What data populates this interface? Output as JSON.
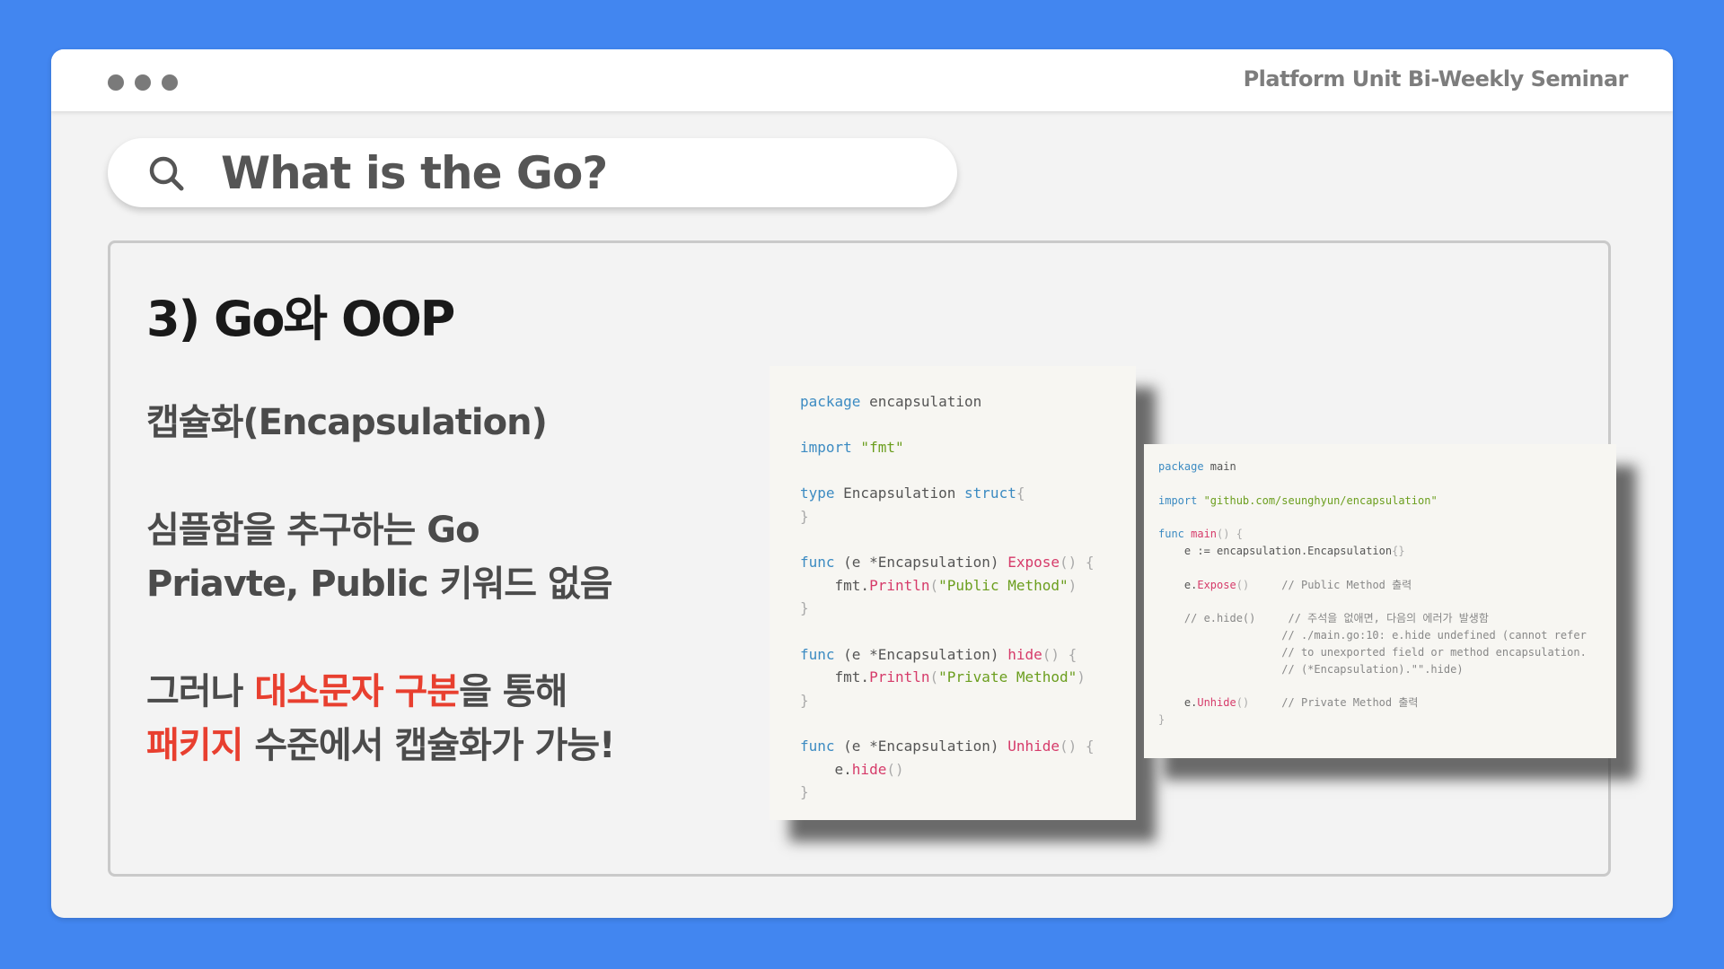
{
  "window": {
    "title": "Platform Unit Bi-Weekly Seminar"
  },
  "search": {
    "query": "What is the Go?",
    "icon": "search-icon"
  },
  "slide": {
    "title": "3) Go와 OOP",
    "subtitle": "캡슐화(Encapsulation)",
    "line1": "심플함을 추구하는 Go",
    "line2": "Priavte, Public 키워드 없음",
    "line3_pre": "그러나 ",
    "line3_highlight": "대소문자 구분",
    "line3_post": "을 통해",
    "line4_highlight": "패키지",
    "line4_post": " 수준에서 캡슐화가 가능!",
    "highlight_color": "#e83f2f"
  },
  "code_left": {
    "l1_kw": "package",
    "l1_rest": " encapsulation",
    "l2_kw": "import",
    "l2_str": " \"fmt\"",
    "l3_kw": "type",
    "l3_mid": " Encapsulation ",
    "l3_kw2": "struct",
    "l3_p": "{",
    "l4": "}",
    "f1_kw": "func",
    "f1_recv": " (e *Encapsulation) ",
    "f1_name": "Expose",
    "f1_p": "() {",
    "f1_body_pre": "    fmt.",
    "f1_body_fn": "Println",
    "f1_body_p1": "(",
    "f1_body_str": "\"Public Method\"",
    "f1_body_p2": ")",
    "f1_end": "}",
    "f2_kw": "func",
    "f2_recv": " (e *Encapsulation) ",
    "f2_name": "hide",
    "f2_p": "() {",
    "f2_body_pre": "    fmt.",
    "f2_body_fn": "Println",
    "f2_body_p1": "(",
    "f2_body_str": "\"Private Method\"",
    "f2_body_p2": ")",
    "f2_end": "}",
    "f3_kw": "func",
    "f3_recv": " (e *Encapsulation) ",
    "f3_name": "Unhide",
    "f3_p": "() {",
    "f3_body_pre": "    e.",
    "f3_body_fn": "hide",
    "f3_body_p": "()",
    "f3_end": "}"
  },
  "code_right": {
    "l1_kw": "package",
    "l1_rest": " main",
    "l2_kw": "import",
    "l2_str": " \"github.com/seunghyun/encapsulation\"",
    "l3_kw": "func",
    "l3_name": " main",
    "l3_p": "() {",
    "l4_pre": "    e := encapsulation.Encapsulation",
    "l4_p": "{}",
    "l5_pre": "    e.",
    "l5_fn": "Expose",
    "l5_p": "()",
    "l5_cm": "     // Public Method 출력",
    "l6_cm": "    // e.hide()     // 주석을 없애면, 다음의 에러가 발생함",
    "l7_cm": "                   // ./main.go:10: e.hide undefined (cannot refer",
    "l8_cm": "                   // to unexported field or method encapsulation.",
    "l9_cm": "                   // (*Encapsulation).\"\".hide)",
    "l10_pre": "    e.",
    "l10_fn": "Unhide",
    "l10_p": "()",
    "l10_cm": "     // Private Method 출력",
    "l11": "}"
  }
}
